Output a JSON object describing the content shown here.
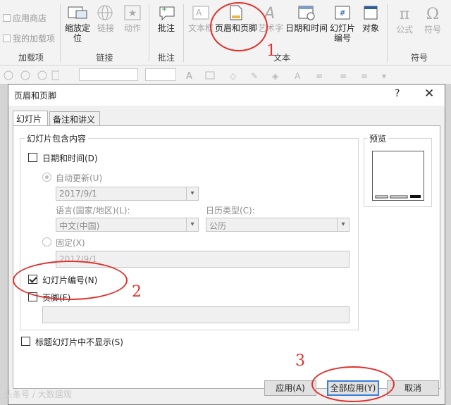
{
  "ribbon": {
    "addins": {
      "items": [
        "应用商店",
        "我的加载项"
      ],
      "label": "加载项"
    },
    "links": {
      "buttons": [
        "缩放定位",
        "链接",
        "动作"
      ],
      "label": "链接"
    },
    "comments": {
      "button": "批注",
      "label": "批注"
    },
    "text": {
      "buttons": [
        "文本框",
        "页眉和页脚",
        "艺术字",
        "日期和时间",
        "幻灯片编号",
        "对象"
      ],
      "label": "文本"
    },
    "symbols": {
      "buttons": [
        "公式",
        "符号"
      ],
      "label": "符号"
    }
  },
  "annotations": {
    "one": "1",
    "two": "2",
    "three": "3"
  },
  "dialog": {
    "title": "页眉和页脚",
    "help": "?",
    "close": "✕",
    "tabs": [
      "幻灯片",
      "备注和讲义"
    ],
    "include_label": "幻灯片包含内容",
    "date_time": {
      "label": "日期和时间(D)",
      "checked": false
    },
    "auto_update": {
      "label": "自动更新(U)",
      "selected": true
    },
    "date_value": "2017/9/1",
    "language_label": "语言(国家/地区)(L):",
    "language_value": "中文(中国)",
    "calendar_label": "日历类型(C):",
    "calendar_value": "公历",
    "fixed": {
      "label": "固定(X)",
      "value": "2017/9/1"
    },
    "slide_number": {
      "label": "幻灯片编号(N)",
      "checked": true
    },
    "footer": {
      "label": "页脚(F)",
      "checked": false,
      "value": ""
    },
    "preview_label": "预览",
    "no_title_slide": {
      "label": "标题幻灯片中不显示(S)",
      "checked": false
    },
    "buttons": {
      "apply": "应用(A)",
      "apply_all": "全部应用(Y)",
      "cancel": "取消"
    }
  },
  "watermark": "头条号 / 大数据观",
  "colors": {
    "annotation": "#e0302c",
    "default_button_border": "#3c7fd8"
  }
}
